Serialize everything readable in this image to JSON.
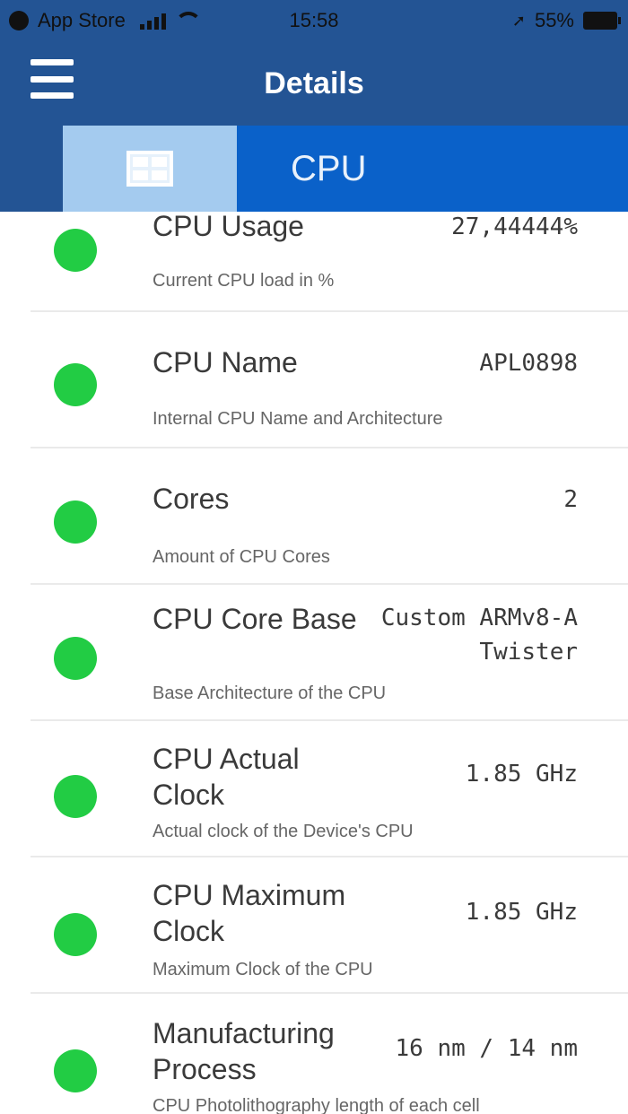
{
  "status_bar": {
    "carrier": "App Store",
    "time": "15:58",
    "battery": "55%"
  },
  "nav": {
    "title": "Details",
    "menu_icon": "hamburger-menu-icon"
  },
  "tabs": {
    "grid_icon": "grid-icon",
    "cpu_label": "CPU"
  },
  "colors": {
    "header": "#235494",
    "active_tab": "#a4cbef",
    "cpu_tab": "#0a61c9",
    "status_ok": "#22cc44"
  },
  "rows": [
    {
      "title": "CPU Usage",
      "value": "27,44444%",
      "desc": "Current CPU load in %"
    },
    {
      "title": "CPU Name",
      "value": "APL0898",
      "desc": "Internal CPU Name and Architecture"
    },
    {
      "title": "Cores",
      "value": "2",
      "desc": "Amount of CPU Cores"
    },
    {
      "title": "CPU Core Base",
      "value": "Custom ARMv8-A Twister",
      "desc": "Base Architecture of the CPU"
    },
    {
      "title": "CPU Actual Clock",
      "value": "1.85 GHz",
      "desc": "Actual clock of the Device's CPU"
    },
    {
      "title": "CPU Maximum Clock",
      "value": "1.85 GHz",
      "desc": "Maximum Clock of the CPU"
    },
    {
      "title": "Manufacturing Process",
      "value": "16 nm / 14 nm",
      "desc": "CPU Photolithography length of each cell"
    }
  ]
}
